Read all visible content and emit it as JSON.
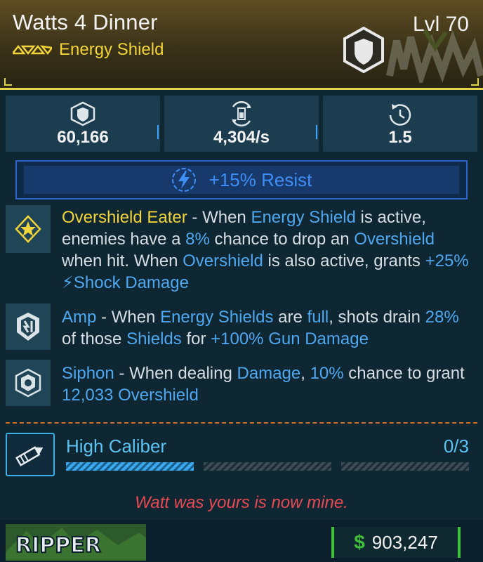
{
  "item": {
    "name": "Watts 4 Dinner",
    "type": "Energy Shield",
    "level": "Lvl 70"
  },
  "stats": [
    {
      "icon": "shield-capacity-icon",
      "value": "60,166"
    },
    {
      "icon": "recharge-rate-icon",
      "value": "4,304/s"
    },
    {
      "icon": "recharge-delay-icon",
      "value": "1.5"
    }
  ],
  "resist": {
    "icon": "lightning-icon",
    "text": "+15% Resist"
  },
  "perks": [
    {
      "icon": "overshield-star-icon",
      "segments": [
        {
          "t": "Overshield Eater",
          "c": "y"
        },
        {
          "t": " - When ",
          "c": ""
        },
        {
          "t": "Energy Shield",
          "c": "b"
        },
        {
          "t": " is active, enemies have a ",
          "c": ""
        },
        {
          "t": "8%",
          "c": "b"
        },
        {
          "t": " chance to drop an ",
          "c": ""
        },
        {
          "t": "Overshield",
          "c": "b"
        },
        {
          "t": " when hit. When ",
          "c": ""
        },
        {
          "t": "Overshield",
          "c": "b"
        },
        {
          "t": " is also active, grants ",
          "c": ""
        },
        {
          "t": "+25% ",
          "c": "b"
        },
        {
          "t": "⚡",
          "c": "b"
        },
        {
          "t": "Shock Damage",
          "c": "b"
        }
      ]
    },
    {
      "icon": "amp-shield-icon",
      "segments": [
        {
          "t": "Amp",
          "c": "b"
        },
        {
          "t": " - When ",
          "c": ""
        },
        {
          "t": "Energy Shields",
          "c": "b"
        },
        {
          "t": " are ",
          "c": ""
        },
        {
          "t": "full",
          "c": "b"
        },
        {
          "t": ", shots drain ",
          "c": ""
        },
        {
          "t": "28%",
          "c": "b"
        },
        {
          "t": " of those ",
          "c": ""
        },
        {
          "t": "Shields",
          "c": "b"
        },
        {
          "t": " for ",
          "c": ""
        },
        {
          "t": "+100% Gun Damage",
          "c": "b"
        }
      ]
    },
    {
      "icon": "siphon-shield-icon",
      "segments": [
        {
          "t": "Siphon",
          "c": "b"
        },
        {
          "t": " - When dealing ",
          "c": ""
        },
        {
          "t": "Damage",
          "c": "b"
        },
        {
          "t": ", ",
          "c": ""
        },
        {
          "t": "10%",
          "c": "b"
        },
        {
          "t": " chance to grant ",
          "c": ""
        },
        {
          "t": "12,033 Overshield",
          "c": "b"
        }
      ]
    }
  ],
  "skill": {
    "icon": "bullet-icon",
    "name": "High Caliber",
    "count": "0/3",
    "progress": 0.333
  },
  "flavor": "Watt was yours is now mine.",
  "manufacturer": {
    "logo": "ripper-logo",
    "text": "RIPPER"
  },
  "price": {
    "icon": "dollar-icon",
    "symbol": "$",
    "value": "903,247"
  },
  "colors": {
    "accent_yellow": "#f2d43a",
    "accent_blue": "#4fa8f0",
    "flavor_red": "#e84a52",
    "price_green": "#3fbf3a"
  }
}
